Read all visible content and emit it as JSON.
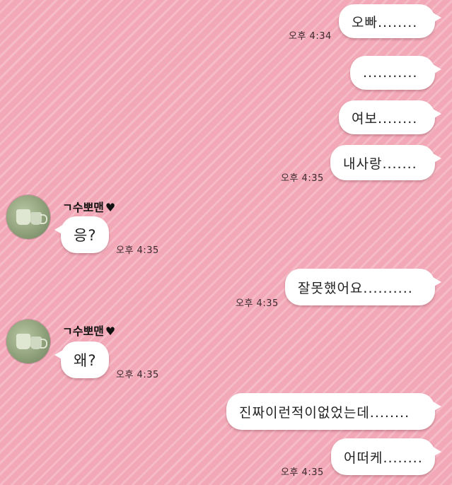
{
  "contact": {
    "name": "ㄱ수뽀맨",
    "heart": "♥"
  },
  "messages": [
    {
      "side": "mine",
      "text": "오빠........",
      "time": ""
    },
    {
      "side": "mine",
      "text": "...........",
      "time": "오후 4:34"
    },
    {
      "side": "mine",
      "text": "여보........",
      "time": ""
    },
    {
      "side": "mine",
      "text": "내사랑.......",
      "time": "오후 4:35"
    },
    {
      "side": "theirs",
      "text": "응?",
      "time": "오후 4:35"
    },
    {
      "side": "mine",
      "text": "잘못했어요..........",
      "time": "오후 4:35"
    },
    {
      "side": "theirs",
      "text": "왜?",
      "time": "오후 4:35"
    },
    {
      "side": "mine",
      "text": "진짜이런적이없었는데........",
      "time": ""
    },
    {
      "side": "mine",
      "text": "어떠케........",
      "time": "오후 4:35"
    }
  ]
}
